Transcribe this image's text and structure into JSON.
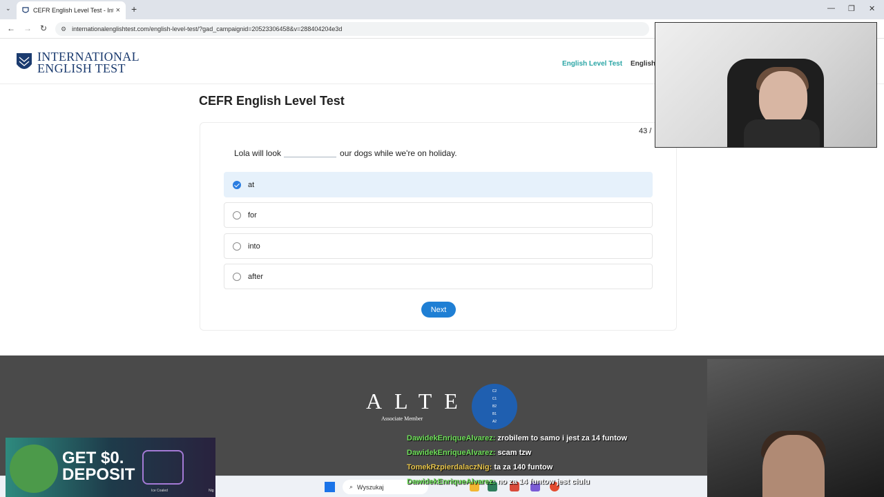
{
  "browser": {
    "tab_title": "CEFR English Level Test - Intern...",
    "url": "internationalenglishtest.com/english-level-test/?gad_campaignid=20523306458&v=288404204e3d",
    "new_tab_symbol": "+",
    "tab_close_symbol": "×",
    "tab_list_symbol": "⌄",
    "back_symbol": "←",
    "forward_symbol": "→",
    "reload_symbol": "↻",
    "minimize_symbol": "—",
    "restore_symbol": "❐",
    "close_symbol": "✕"
  },
  "site": {
    "logo_line1": "INTERNATIONAL",
    "logo_line2": "ENGLISH TEST",
    "nav_active": "English Level Test",
    "nav_other": "English"
  },
  "test": {
    "title": "CEFR English Level Test",
    "counter": "43 /",
    "question_before": "Lola will look",
    "question_after": "our dogs while we're on holiday.",
    "options": [
      {
        "label": "at",
        "selected": true
      },
      {
        "label": "for",
        "selected": false
      },
      {
        "label": "into",
        "selected": false
      },
      {
        "label": "after",
        "selected": false
      }
    ],
    "next_label": "Next"
  },
  "footer": {
    "alte_letters": "ALTE",
    "alte_sub": "Associate Member",
    "badge_levels": [
      "C2",
      "C1",
      "B2",
      "B1",
      "A2"
    ]
  },
  "stream": {
    "ad_text_line1": "GET $0.",
    "ad_text_line2": "DEPOSIT",
    "ad_caption": "Ice Coaled",
    "ad_caption2": "Nig",
    "chat": [
      {
        "user": "DawidekEnriqueAlvarez:",
        "message": "zrobilem to samo i jest za 14 funtow",
        "gold": false
      },
      {
        "user": "DawidekEnriqueAlvarez:",
        "message": "scam tzw",
        "gold": false
      },
      {
        "user": "TomekRzpierdalaczNig:",
        "message": "ta za 140 funtow",
        "gold": true
      },
      {
        "user": "DawidekEnriqueAlvarez:",
        "message": "no za 14 funtow jest ciulu",
        "gold": false
      }
    ],
    "taskbar_search": "Wyszukaj"
  }
}
